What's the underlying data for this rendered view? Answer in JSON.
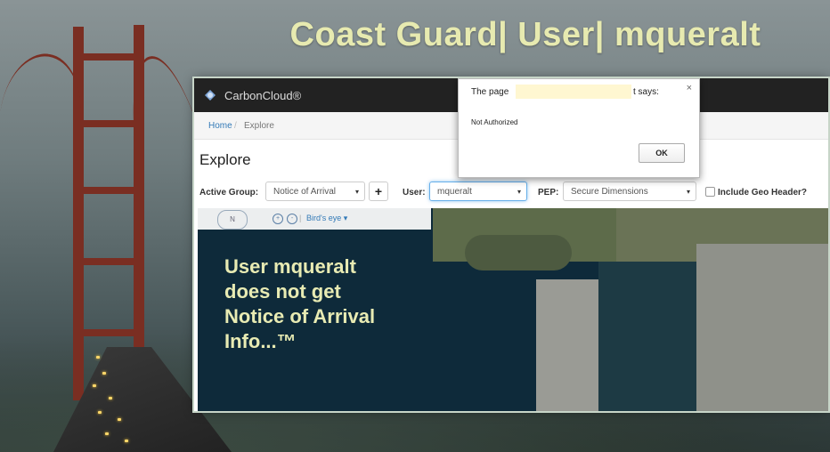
{
  "slide": {
    "title": "Coast Guard| User| mqueralt",
    "overlay_lines": [
      "User mqueralt",
      "does not get",
      "Notice of Arrival",
      "Info...™"
    ]
  },
  "app": {
    "brand": "CarbonCloud®",
    "breadcrumb": {
      "home": "Home",
      "separator": "/",
      "current": "Explore"
    },
    "page_title": "Explore",
    "toolbar": {
      "active_group_label": "Active Group:",
      "active_group_value": "Notice of Arrival",
      "plus_label": "+",
      "user_label": "User:",
      "user_value": "mqueralt",
      "pep_label": "PEP:",
      "pep_value": "Secure Dimensions",
      "geo_header_label": "Include Geo Header?",
      "geo_header_checked": false,
      "caret": "▾"
    },
    "map": {
      "compass_label": "N",
      "zoom_in": "+",
      "zoom_out": "-",
      "separator": "|",
      "view_mode": "Bird's eye ▾"
    }
  },
  "dialog": {
    "title_prefix": "The page",
    "title_suffix": "t says:",
    "message": "Not Authorized",
    "ok_label": "OK",
    "close_label": "×"
  },
  "colors": {
    "title_text": "#e7eab0",
    "navbar": "#222222",
    "bridge": "#7a2e22",
    "link": "#337ab7"
  }
}
